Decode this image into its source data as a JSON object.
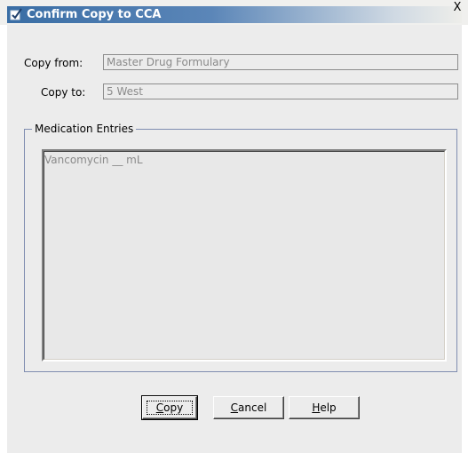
{
  "dialog": {
    "title": "Confirm Copy to CCA",
    "close_label": "X"
  },
  "form": {
    "copy_from_label": "Copy from:",
    "copy_from_value": "Master Drug Formulary",
    "copy_to_label": "Copy to:",
    "copy_to_value": "5 West"
  },
  "medication_entries": {
    "legend": "Medication Entries",
    "items": [
      "Vancomycin __ mL"
    ]
  },
  "buttons": {
    "copy": {
      "mnemonic": "C",
      "rest": "opy"
    },
    "cancel": {
      "mnemonic": "C",
      "rest": "ancel"
    },
    "help": {
      "mnemonic": "H",
      "rest": "elp"
    }
  }
}
